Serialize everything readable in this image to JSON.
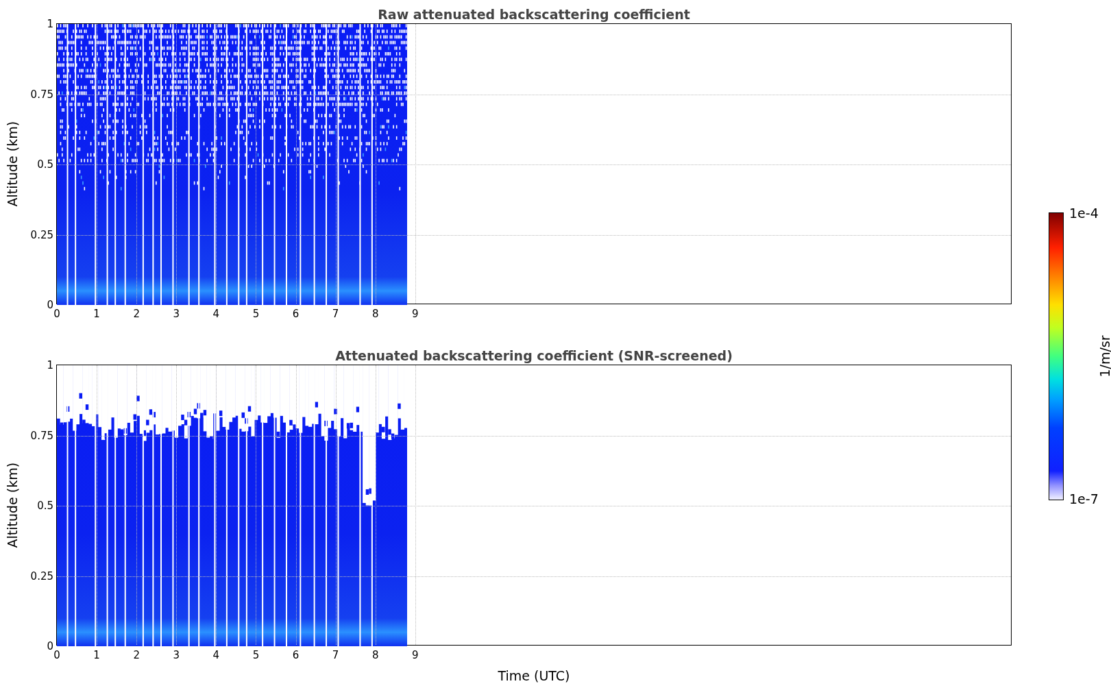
{
  "panels": [
    {
      "kind": "raw",
      "title": "Raw attenuated backscattering coefficient",
      "ylabel": "Altitude (km)",
      "yticks": [
        "1",
        "0.75",
        "0.5",
        "0.25",
        "0"
      ],
      "xticks": [
        "0",
        "1",
        "2",
        "3",
        "4",
        "5",
        "6",
        "7",
        "8",
        "9"
      ]
    },
    {
      "kind": "screened",
      "title": "Attenuated backscattering coefficient (SNR-screened)",
      "ylabel": "Altitude (km)",
      "yticks": [
        "1",
        "0.75",
        "0.5",
        "0.25",
        "0"
      ],
      "xticks": [
        "0",
        "1",
        "2",
        "3",
        "4",
        "5",
        "6",
        "7",
        "8",
        "9"
      ]
    }
  ],
  "xlabel": "Time (UTC)",
  "colorbar": {
    "max_label": "1e-4",
    "min_label": "1e-7",
    "label": "1/m/sr"
  }
}
